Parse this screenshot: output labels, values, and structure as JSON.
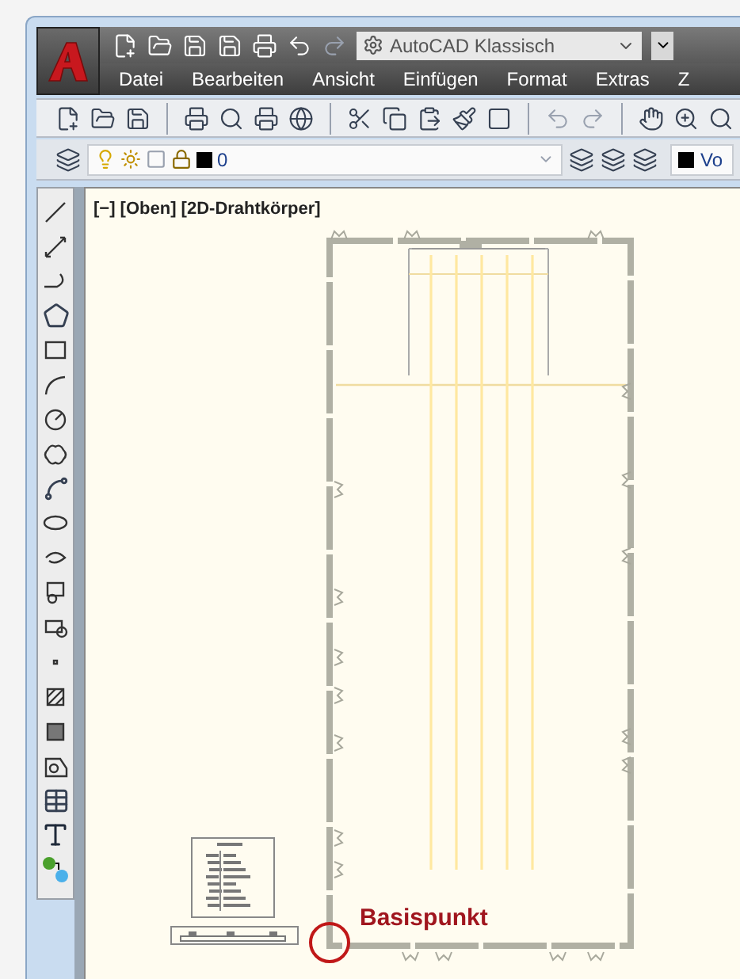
{
  "quick_access": {
    "workspace": "AutoCAD Klassisch"
  },
  "menu": [
    "Datei",
    "Bearbeiten",
    "Ansicht",
    "Einfügen",
    "Format",
    "Extras",
    "Z"
  ],
  "layer_toolbar": {
    "layer_name": "0",
    "color_control": "Vo"
  },
  "viewport": {
    "label": "[−] [Oben] [2D-Drahtkörper]",
    "annotation": "Basispunkt"
  }
}
